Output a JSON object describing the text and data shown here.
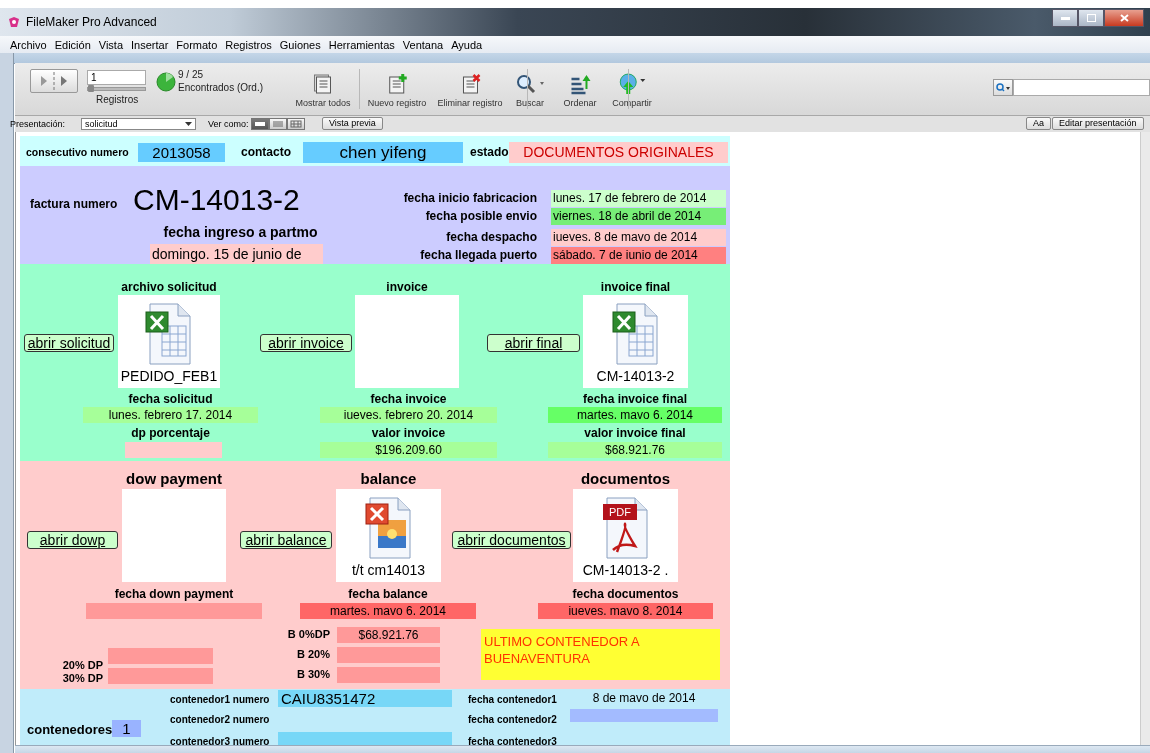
{
  "window": {
    "title": "FileMaker Pro Advanced"
  },
  "menu": [
    "Archivo",
    "Edición",
    "Vista",
    "Insertar",
    "Formato",
    "Registros",
    "Guiones",
    "Herramientas",
    "Ventana",
    "Ayuda"
  ],
  "toolbar": {
    "record_number": "1",
    "record_slider": {
      "level": 0
    },
    "records_label": "Registros",
    "found_count": "9 / 25",
    "found_label": "Encontrados (Ord.)",
    "buttons": [
      {
        "kind": "show_all",
        "label": "Mostrar todos"
      },
      {
        "kind": "new",
        "label": "Nuevo registro"
      },
      {
        "kind": "delete",
        "label": "Eliminar registro"
      },
      {
        "kind": "find",
        "label": "Buscar"
      },
      {
        "kind": "sort",
        "label": "Ordenar"
      },
      {
        "kind": "share",
        "label": "Compartir"
      }
    ]
  },
  "layout_bar": {
    "layout_label": "Presentación:",
    "layout_value": "solicitud",
    "view_label": "Ver como:",
    "view_modes": [
      {
        "kind": "form",
        "selected": true
      },
      {
        "kind": "list",
        "selected": false
      },
      {
        "kind": "table",
        "selected": false
      }
    ],
    "preview_button": "Vista previa",
    "font_button": "Aa",
    "edit_button": "Editar presentación"
  },
  "header": {
    "consecutivo_label": "consecutivo numero",
    "consecutivo_value": "2013058",
    "contacto_label": "contacto",
    "contacto_value": "chen yifeng",
    "estado_label": "estado",
    "estado_value": "DOCUMENTOS ORIGINALES"
  },
  "factura": {
    "label": "factura numero",
    "value": "CM-14013-2",
    "ingreso_label": "fecha ingreso a partmo",
    "ingreso_value": "domingo. 15 de junio de",
    "dates": [
      {
        "label": "fecha inicio fabricacion",
        "value": "lunes. 17 de febrero de 2014",
        "color": "#ccffcc"
      },
      {
        "label": "fecha posible envio",
        "value": "viernes. 18 de abril de 2014",
        "color": "#77ee77"
      },
      {
        "label": "fecha despacho",
        "value": "iueves. 8 de mavo de 2014",
        "color": "#ffcccc"
      },
      {
        "label": "fecha llegada puerto",
        "value": "sábado. 7 de iunio de 2014",
        "color": "#ff8080"
      }
    ]
  },
  "files": [
    {
      "title": "archivo solicitud",
      "button": "abrir solicitud",
      "kind": "spreadsheet",
      "file_name": "PEDIDO_FEB1",
      "date_label": "fecha solicitud",
      "date_value": "lunes. febrero 17. 2014",
      "value_label": "dp porcentaje"
    },
    {
      "title": "invoice",
      "button": "abrir invoice",
      "kind": "empty",
      "date_label": "fecha invoice",
      "date_value": "iueves. febrero 20. 2014",
      "value_label": "valor invoice",
      "value": "$196.209.60"
    },
    {
      "title": "invoice final",
      "button": "abrir final",
      "kind": "spreadsheet",
      "file_name": "CM-14013-2",
      "date_label": "fecha invoice final",
      "date_value": "martes. mavo 6. 2014",
      "value_label": "valor invoice final",
      "value": "$68.921.76"
    }
  ],
  "payments": [
    {
      "title": "dow payment",
      "button": "abrir dowp",
      "kind": "empty",
      "date_label": "fecha down payment"
    },
    {
      "title": "balance",
      "button": "abrir balance",
      "kind": "image",
      "file_name": "t/t cm14013",
      "date_label": "fecha balance",
      "date_value": "martes. mavo 6. 2014"
    },
    {
      "title": "documentos",
      "button": "abrir documentos",
      "kind": "pdf",
      "file_badge": "PDF",
      "file_name": "CM-14013-2 .",
      "date_label": "fecha documentos",
      "date_value": "iueves. mavo 8. 2014"
    }
  ],
  "balances": [
    {
      "label": "B 0%DP",
      "value": "$68.921.76"
    },
    {
      "label": "B 20%"
    },
    {
      "label": "B 30%"
    }
  ],
  "down_payments": [
    {
      "label": "20% DP"
    },
    {
      "label": "30% DP"
    }
  ],
  "note": "ULTIMO CONTENEDOR A BUENAVENTURA",
  "containers": {
    "count_label": "contenedores",
    "count": "1",
    "rows": [
      {
        "number_label": "contenedor1 numero",
        "number": "CAIU8351472",
        "date_label": "fecha contenedor1",
        "date": "8 de mavo de 2014"
      },
      {
        "number_label": "contenedor2 numero",
        "date_label": "fecha contenedor2"
      },
      {
        "number_label": "contenedor3 numero",
        "date_label": "fecha contenedor3"
      }
    ]
  }
}
